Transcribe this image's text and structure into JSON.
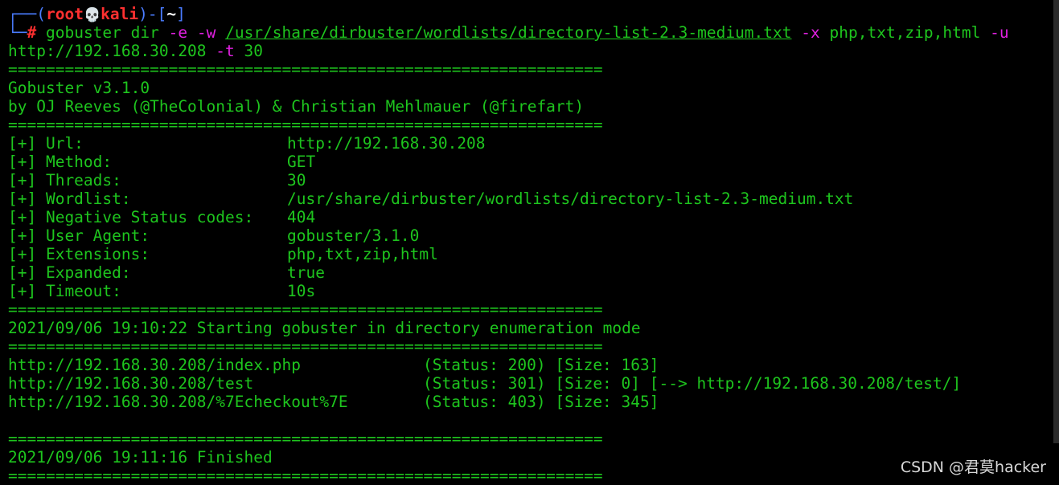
{
  "prompt": {
    "corner_top": "┌──(",
    "user": "root",
    "skull": "💀",
    "host": "kali",
    "close_paren": ")-[",
    "dir": "~",
    "close_bracket": "]",
    "corner_bottom": "└─",
    "hash": "#"
  },
  "command": {
    "program": "gobuster",
    "subcommand": "dir",
    "opt_e": "-e",
    "opt_w": "-w",
    "wordlist": "/usr/share/dirbuster/wordlists/directory-list-2.3-medium.txt",
    "opt_x": "-x",
    "extensions": "php,txt,zip,html",
    "opt_u": "-u",
    "url": "http://192.168.30.208",
    "opt_t": "-t",
    "threads": "30"
  },
  "separator": "===============================================================",
  "banner": {
    "version": "Gobuster v3.1.0",
    "authors": "by OJ Reeves (@TheColonial) & Christian Mehlmauer (@firefart)"
  },
  "config": [
    {
      "label": "[+] Url:",
      "value": "http://192.168.30.208"
    },
    {
      "label": "[+] Method:",
      "value": "GET"
    },
    {
      "label": "[+] Threads:",
      "value": "30"
    },
    {
      "label": "[+] Wordlist:",
      "value": "/usr/share/dirbuster/wordlists/directory-list-2.3-medium.txt"
    },
    {
      "label": "[+] Negative Status codes:",
      "value": "404"
    },
    {
      "label": "[+] User Agent:",
      "value": "gobuster/3.1.0"
    },
    {
      "label": "[+] Extensions:",
      "value": "php,txt,zip,html"
    },
    {
      "label": "[+] Expanded:",
      "value": "true"
    },
    {
      "label": "[+] Timeout:",
      "value": "10s"
    }
  ],
  "start_message": "2021/09/06 19:10:22 Starting gobuster in directory enumeration mode",
  "results": [
    {
      "url": "http://192.168.30.208/index.php",
      "status": "(Status: 200) [Size: 163]"
    },
    {
      "url": "http://192.168.30.208/test",
      "status": "(Status: 301) [Size: 0] [--> http://192.168.30.208/test/]"
    },
    {
      "url": "http://192.168.30.208/%7Echeckout%7E",
      "status": "(Status: 403) [Size: 345]"
    }
  ],
  "finish_message": "2021/09/06 19:11:16 Finished",
  "watermark": "CSDN @君莫hacker"
}
